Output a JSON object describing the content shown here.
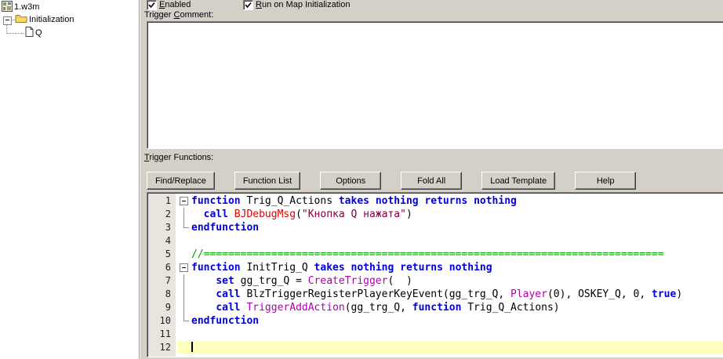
{
  "colors": {
    "keyword": "#0000E0",
    "comment": "#00A000",
    "bj_function": "#E00000",
    "native": "#B000B0",
    "string": "#800040",
    "current_line_bg": "#FFFFBE",
    "panel_bg": "#D4D0C8"
  },
  "tree": {
    "items": [
      {
        "label": "1.w3m",
        "icon": "map-icon",
        "level": 0
      },
      {
        "label": "Initialization",
        "icon": "folder-icon",
        "level": 1,
        "expanded": true
      },
      {
        "label": "Q",
        "icon": "page-icon",
        "level": 2
      }
    ]
  },
  "header": {
    "enabled": {
      "accel": "E",
      "rest": "nabled",
      "checked": true
    },
    "run_on_init": {
      "accel": "R",
      "rest": "un on Map Initialization",
      "checked": true
    },
    "comment_label": {
      "pre": "Trigger ",
      "accel": "C",
      "rest": "omment:"
    },
    "functions_label": {
      "pre": "",
      "accel": "T",
      "rest": "rigger Functions:"
    }
  },
  "comment_box": {
    "value": ""
  },
  "toolbar": {
    "buttons": [
      "Find/Replace",
      "Function List",
      "Options",
      "Fold All",
      "Load Template",
      "Help"
    ]
  },
  "editor": {
    "current_line": 12,
    "lines": [
      {
        "num": "1",
        "fold": "start",
        "tokens": [
          [
            "kw",
            "function"
          ],
          [
            "pl",
            " Trig_Q_Actions "
          ],
          [
            "kw",
            "takes"
          ],
          [
            "pl",
            " "
          ],
          [
            "kw",
            "nothing"
          ],
          [
            "pl",
            " "
          ],
          [
            "kw",
            "returns"
          ],
          [
            "pl",
            " "
          ],
          [
            "kw",
            "nothing"
          ]
        ]
      },
      {
        "num": "2",
        "fold": "mid",
        "tokens": [
          [
            "pl",
            "  "
          ],
          [
            "kw",
            "call"
          ],
          [
            "pl",
            " "
          ],
          [
            "bj",
            "BJDebugMsg"
          ],
          [
            "pl",
            "("
          ],
          [
            "str",
            "\"Кнопка Q нажата\""
          ],
          [
            "pl",
            ")"
          ]
        ]
      },
      {
        "num": "3",
        "fold": "end",
        "tokens": [
          [
            "kw",
            "endfunction"
          ]
        ]
      },
      {
        "num": "4",
        "fold": "none",
        "tokens": []
      },
      {
        "num": "5",
        "fold": "none",
        "tokens": [
          [
            "com",
            "//==========================================================================="
          ]
        ]
      },
      {
        "num": "6",
        "fold": "start",
        "tokens": [
          [
            "kw",
            "function"
          ],
          [
            "pl",
            " InitTrig_Q "
          ],
          [
            "kw",
            "takes"
          ],
          [
            "pl",
            " "
          ],
          [
            "kw",
            "nothing"
          ],
          [
            "pl",
            " "
          ],
          [
            "kw",
            "returns"
          ],
          [
            "pl",
            " "
          ],
          [
            "kw",
            "nothing"
          ]
        ]
      },
      {
        "num": "7",
        "fold": "mid",
        "tokens": [
          [
            "pl",
            "    "
          ],
          [
            "kw",
            "set"
          ],
          [
            "pl",
            " gg_trg_Q = "
          ],
          [
            "nat",
            "CreateTrigger"
          ],
          [
            "pl",
            "(  )"
          ]
        ]
      },
      {
        "num": "8",
        "fold": "mid",
        "tokens": [
          [
            "pl",
            "    "
          ],
          [
            "kw",
            "call"
          ],
          [
            "pl",
            " BlzTriggerRegisterPlayerKeyEvent(gg_trg_Q, "
          ],
          [
            "nat",
            "Player"
          ],
          [
            "pl",
            "(0), OSKEY_Q, 0, "
          ],
          [
            "kw",
            "true"
          ],
          [
            "pl",
            ")"
          ]
        ]
      },
      {
        "num": "9",
        "fold": "mid",
        "tokens": [
          [
            "pl",
            "    "
          ],
          [
            "kw",
            "call"
          ],
          [
            "pl",
            " "
          ],
          [
            "nat",
            "TriggerAddAction"
          ],
          [
            "pl",
            "(gg_trg_Q, "
          ],
          [
            "kw",
            "function"
          ],
          [
            "pl",
            " Trig_Q_Actions)"
          ]
        ]
      },
      {
        "num": "10",
        "fold": "end",
        "tokens": [
          [
            "kw",
            "endfunction"
          ]
        ]
      },
      {
        "num": "11",
        "fold": "none",
        "tokens": []
      },
      {
        "num": "12",
        "fold": "none",
        "current": true,
        "tokens": []
      }
    ]
  }
}
